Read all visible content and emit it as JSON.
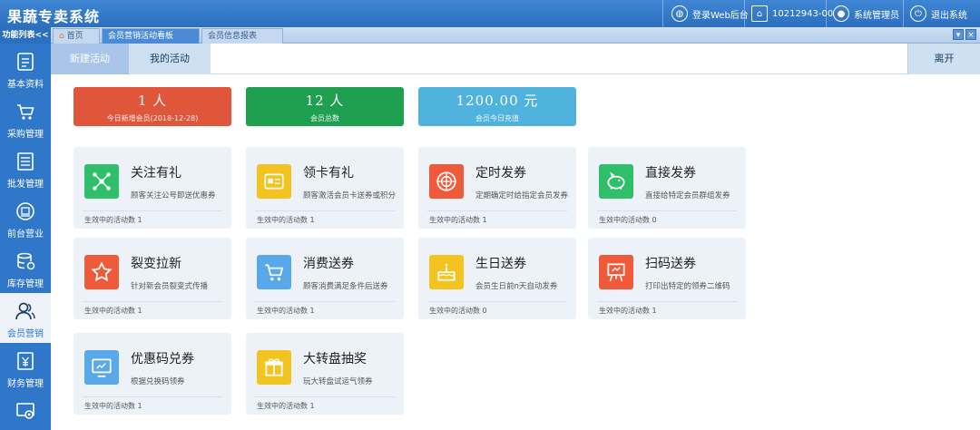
{
  "app": {
    "title": "果蔬专卖系统",
    "login_web": "登录Web后台",
    "account": "10212943-00",
    "user": "系统管理员",
    "logout": "退出系统"
  },
  "tabstrip": {
    "func_list": "功能列表<<",
    "tabs": [
      {
        "label": "首页"
      },
      {
        "label": "会员营销活动看板"
      },
      {
        "label": "会员信息报表"
      }
    ],
    "win_min": "▾",
    "win_close": "×"
  },
  "sidebar": {
    "items": [
      {
        "label": "基本资料",
        "icon": "file-icon"
      },
      {
        "label": "采购管理",
        "icon": "cart-icon"
      },
      {
        "label": "批发管理",
        "icon": "list-icon"
      },
      {
        "label": "前台营业",
        "icon": "pos-icon"
      },
      {
        "label": "库存管理",
        "icon": "database-icon"
      },
      {
        "label": "会员营销",
        "icon": "user-group-icon"
      },
      {
        "label": "财务管理",
        "icon": "yen-icon"
      },
      {
        "label": "",
        "icon": "settings-icon"
      }
    ]
  },
  "subnav": {
    "new": "新建活动",
    "mine": "我的活动",
    "leave": "离开"
  },
  "stats": [
    {
      "value": "1 人",
      "label": "今日新增会员(2018-12-28)",
      "color": "#e0563b"
    },
    {
      "value": "12 人",
      "label": "会员总数",
      "color": "#1fa050"
    },
    {
      "value": "1200.00 元",
      "label": "会员今日充值",
      "color": "#4fb3de"
    }
  ],
  "cards": [
    {
      "title": "关注有礼",
      "desc": "顾客关注公号即送优惠券",
      "foot": "生效中的活动数 1",
      "icon": "share-network-icon",
      "color": "#2fbf6b"
    },
    {
      "title": "领卡有礼",
      "desc": "顾客激活会员卡送券或积分",
      "foot": "生效中的活动数 1",
      "icon": "card-icon",
      "color": "#f3c320"
    },
    {
      "title": "定时发券",
      "desc": "定期确定时给指定会员发券",
      "foot": "生效中的活动数 1",
      "icon": "target-icon",
      "color": "#ef5b3a"
    },
    {
      "title": "直接发券",
      "desc": "直接给特定会员群组发券",
      "foot": "生效中的活动数 0",
      "icon": "piggy-bank-icon",
      "color": "#2fbf6b"
    },
    {
      "title": "裂变拉新",
      "desc": "针对新会员裂变式传播",
      "foot": "生效中的活动数 1",
      "icon": "star-icon",
      "color": "#ef5b3a"
    },
    {
      "title": "消费送券",
      "desc": "顾客消费满足条件后送券",
      "foot": "生效中的活动数 1",
      "icon": "cart-icon",
      "color": "#58a8ea"
    },
    {
      "title": "生日送券",
      "desc": "会员生日前n天自动发券",
      "foot": "生效中的活动数 0",
      "icon": "cake-icon",
      "color": "#f3c320"
    },
    {
      "title": "扫码送券",
      "desc": "打印出特定的领券二维码",
      "foot": "生效中的活动数 1",
      "icon": "easel-icon",
      "color": "#ef5b3a"
    },
    {
      "title": "优惠码兑券",
      "desc": "根据兑换码领券",
      "foot": "生效中的活动数 1",
      "icon": "monitor-icon",
      "color": "#58a8ea"
    },
    {
      "title": "大转盘抽奖",
      "desc": "玩大转盘试运气领券",
      "foot": "生效中的活动数 1",
      "icon": "gift-box-icon",
      "color": "#f3c320"
    }
  ]
}
